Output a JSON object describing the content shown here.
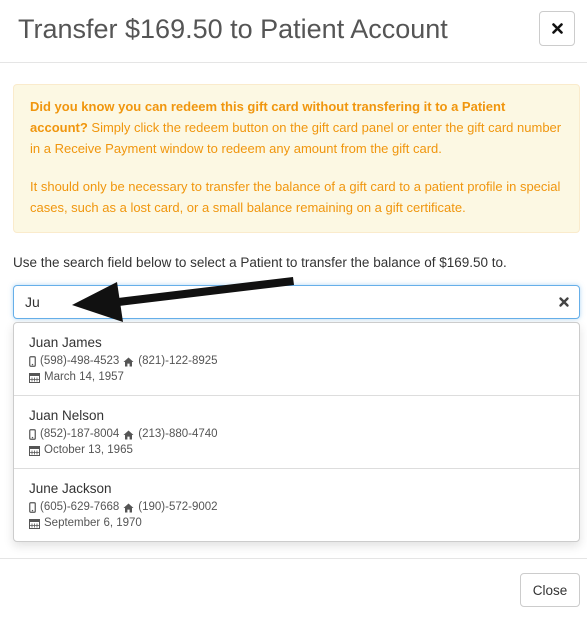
{
  "modal": {
    "title": "Transfer $169.50 to Patient Account"
  },
  "alert": {
    "bold_text": "Did you know you can redeem this gift card without transfering it to a Patient account?",
    "text": " Simply click the redeem button on the gift card panel or enter the gift card number in a Receive Payment window to redeem any amount from the gift card.",
    "note": "It should only be necessary to transfer the balance of a gift card to a patient profile in special cases, such as a lost card, or a small balance remaining on a gift certificate."
  },
  "instructions": "Use the search field below to select a Patient to transfer the balance of $169.50 to.",
  "search": {
    "value": "Ju",
    "placeholder": ""
  },
  "results": [
    {
      "name": "Juan James",
      "mobile": "(598)-498-4523",
      "home": "(821)-122-8925",
      "dob": "March 14, 1957"
    },
    {
      "name": "Juan Nelson",
      "mobile": "(852)-187-8004",
      "home": "(213)-880-4740",
      "dob": "October 13, 1965"
    },
    {
      "name": "June Jackson",
      "mobile": "(605)-629-7668",
      "home": "(190)-572-9002",
      "dob": "September 6, 1970"
    }
  ],
  "footer": {
    "close_label": "Close"
  },
  "icons": {
    "close": "close-icon",
    "clear": "clear-icon",
    "mobile": "mobile-phone-icon",
    "home": "home-icon",
    "calendar": "calendar-icon"
  },
  "colors": {
    "alert_text": "#f0960e",
    "alert_bg": "#fcf8e3",
    "focus_border": "#66afe9"
  }
}
